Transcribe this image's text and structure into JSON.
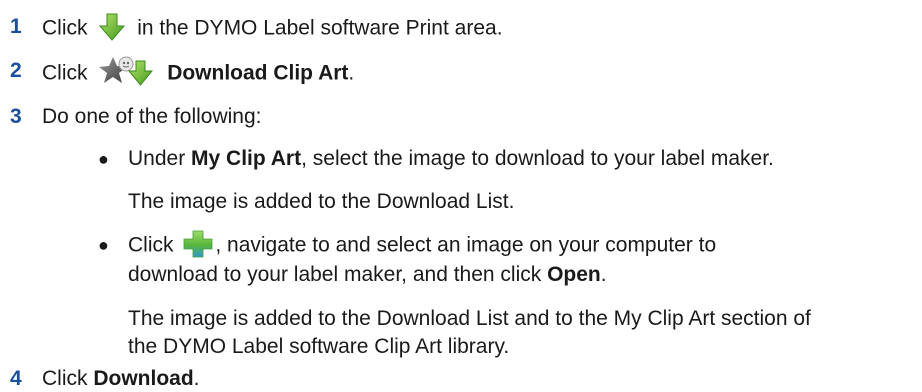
{
  "steps": [
    {
      "number": "1",
      "before": "Click",
      "icon": "green-download-arrow-icon",
      "after": "in the DYMO Label software Print area."
    },
    {
      "number": "2",
      "before": "Click",
      "icon": "download-clip-art-icon",
      "bold": "Download Clip Art",
      "after": "."
    },
    {
      "number": "3",
      "text": "Do one of the following:",
      "bullets": [
        {
          "before": "Under",
          "bold": "My Clip Art",
          "after": ", select the image to download to your label maker.",
          "result": "The image is added to the Download List."
        },
        {
          "before": "Click",
          "icon": "green-plus-icon",
          "after": ", navigate to and select an image on your computer to",
          "after_line2": "download to your label maker, and then click",
          "bold": "Open",
          "end": ".",
          "result": "The image is added to the Download List and to the My Clip Art section of",
          "result_line2": "the DYMO Label software Clip Art library."
        }
      ]
    },
    {
      "number": "4",
      "before": "Click",
      "bold": "Download",
      "after": "."
    }
  ],
  "colors": {
    "step_number": "#1a4f9c",
    "text": "#1a1a1a",
    "arrow_green": "#5fb82c",
    "plus_green": "#6cc04a",
    "plus_blue": "#3aa0d8",
    "star_gray": "#7a7a7a"
  }
}
